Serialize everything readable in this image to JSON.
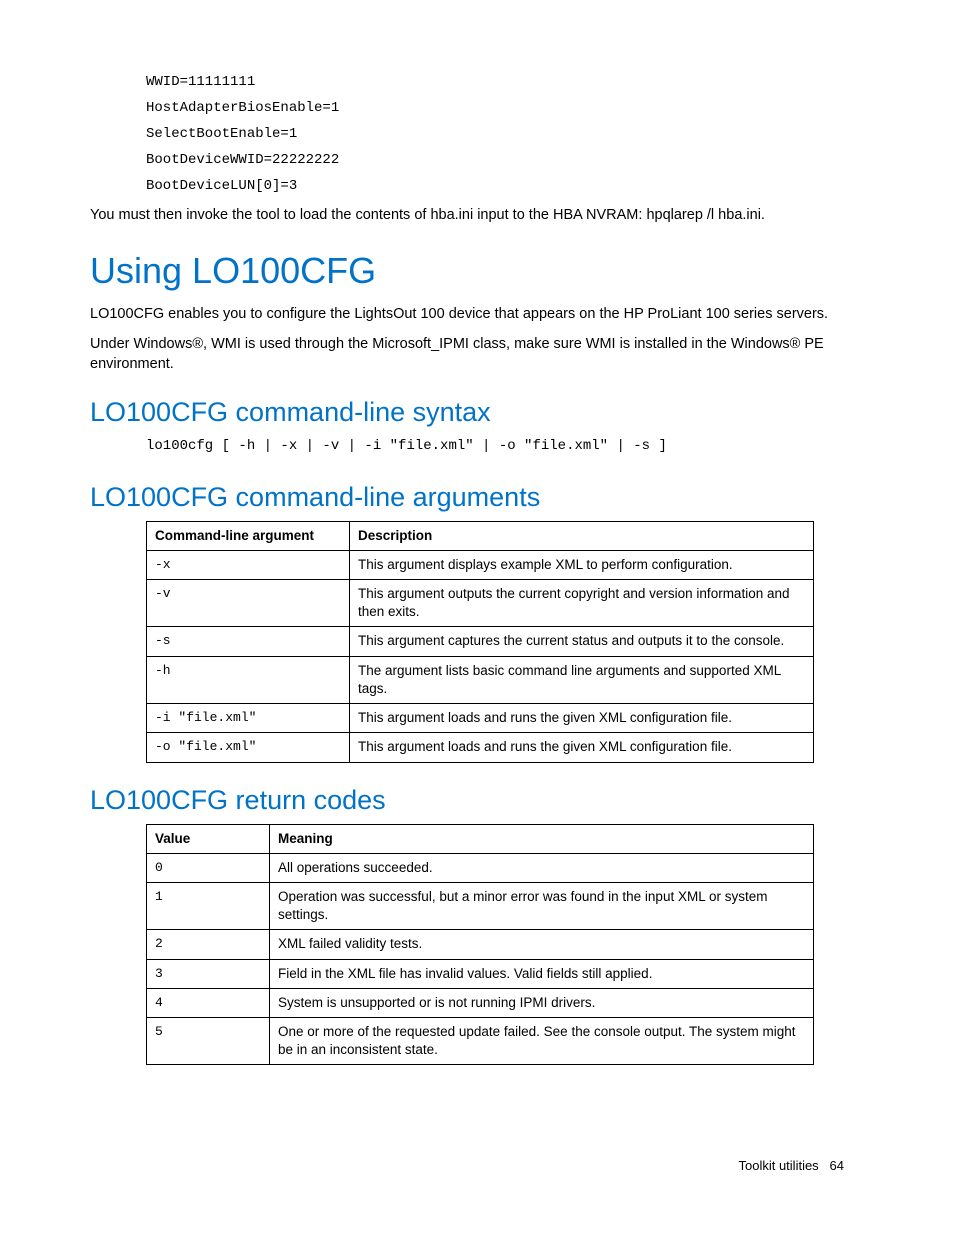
{
  "intro": {
    "code_lines": [
      "WWID=11111111",
      "HostAdapterBiosEnable=1",
      "SelectBootEnable=1",
      "BootDeviceWWID=22222222",
      "BootDeviceLUN[0]=3"
    ],
    "post_text": "You must then invoke the tool to load the contents of hba.ini input to the HBA NVRAM: hpqlarep /l hba.ini."
  },
  "section_main_title": "Using LO100CFG",
  "section_main_p1": "LO100CFG enables you to configure the LightsOut 100 device that appears on the HP ProLiant 100 series servers.",
  "section_main_p2": "Under Windows®, WMI is used through the Microsoft_IPMI class, make sure WMI is installed in the Windows® PE environment.",
  "syntax_title": "LO100CFG command-line syntax",
  "syntax_code": "lo100cfg [ -h | -x | -v | -i \"file.xml\" | -o \"file.xml\" | -s ]",
  "args_title": "LO100CFG command-line arguments",
  "args_table": {
    "headers": [
      "Command-line argument",
      "Description"
    ],
    "rows": [
      {
        "arg": "-x",
        "desc": "This argument displays example XML to perform configuration."
      },
      {
        "arg": "-v",
        "desc": "This argument outputs the current copyright and version information and then exits."
      },
      {
        "arg": "-s",
        "desc": "This argument captures the current status and outputs it to the console."
      },
      {
        "arg": "-h",
        "desc": "The argument lists basic command line arguments and supported XML tags."
      },
      {
        "arg": "-i \"file.xml\"",
        "desc": "This argument loads and runs the given XML configuration file."
      },
      {
        "arg": "-o \"file.xml\"",
        "desc": "This argument loads and runs the given XML configuration file."
      }
    ]
  },
  "codes_title": "LO100CFG return codes",
  "codes_table": {
    "headers": [
      "Value",
      "Meaning"
    ],
    "rows": [
      {
        "val": "0",
        "desc": "All operations succeeded."
      },
      {
        "val": "1",
        "desc": "Operation was successful, but a minor error was found in the input XML or system settings."
      },
      {
        "val": "2",
        "desc": "XML failed validity tests."
      },
      {
        "val": "3",
        "desc": "Field in the XML file has invalid values. Valid fields still applied."
      },
      {
        "val": "4",
        "desc": "System is unsupported or is not running IPMI drivers."
      },
      {
        "val": "5",
        "desc": "One or more of the requested update failed. See the console output. The system might be in an inconsistent state."
      }
    ]
  },
  "footer": {
    "label": "Toolkit utilities",
    "page": "64"
  }
}
